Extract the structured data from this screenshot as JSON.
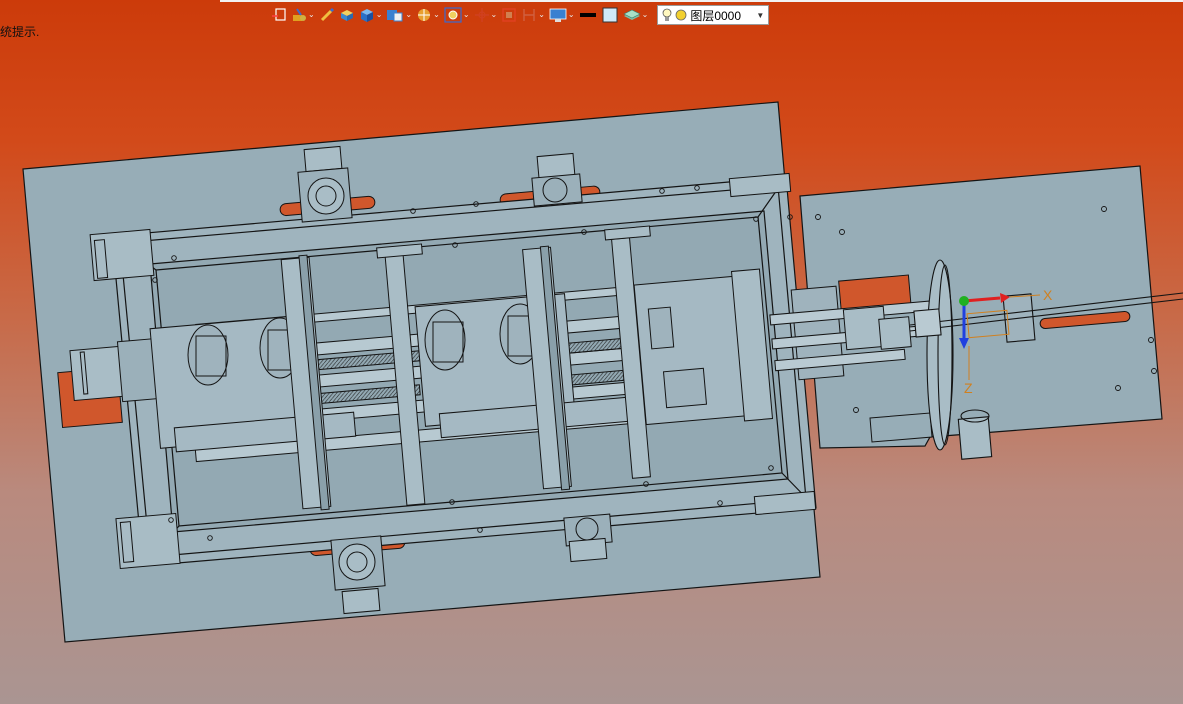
{
  "viewport": {
    "hint": "统提示.",
    "background_top": "#cc3b0a",
    "background_bottom": "#aa9592"
  },
  "toolbar": {
    "tools": [
      {
        "icon": "select-filter-icon",
        "has_dropdown": false
      },
      {
        "icon": "sketch-tool-icon",
        "has_dropdown": true
      },
      {
        "icon": "pencil-icon",
        "has_dropdown": false
      },
      {
        "icon": "solid-box-icon",
        "has_dropdown": false
      },
      {
        "icon": "blue-cube-icon",
        "has_dropdown": true
      },
      {
        "icon": "view-orient-icon",
        "has_dropdown": true
      },
      {
        "icon": "render-sphere-icon",
        "has_dropdown": true
      },
      {
        "icon": "zoom-fit-icon",
        "has_dropdown": true
      },
      {
        "icon": "pan-icon",
        "has_dropdown": true
      },
      {
        "icon": "section-view-icon",
        "has_dropdown": false
      },
      {
        "icon": "measure-icon",
        "has_dropdown": true
      },
      {
        "icon": "display-monitor-icon",
        "has_dropdown": true
      },
      {
        "icon": "line-color-icon",
        "has_dropdown": false
      },
      {
        "icon": "fill-color-icon",
        "has_dropdown": false
      },
      {
        "icon": "layer-stack-icon",
        "has_dropdown": true
      }
    ],
    "layer": {
      "name": "图层0000",
      "visible_icon": "lightbulb-icon",
      "state_icon": "yellow-dot-icon"
    }
  },
  "triad": {
    "x_label": "X",
    "z_label": "Z",
    "x_color": "#e02020",
    "y_color": "#20b020",
    "z_color": "#2040e0",
    "label_color": "#d08020"
  },
  "colors": {
    "plate": "#99aeb8",
    "edge": "#141414",
    "slot": "#d0572c"
  }
}
